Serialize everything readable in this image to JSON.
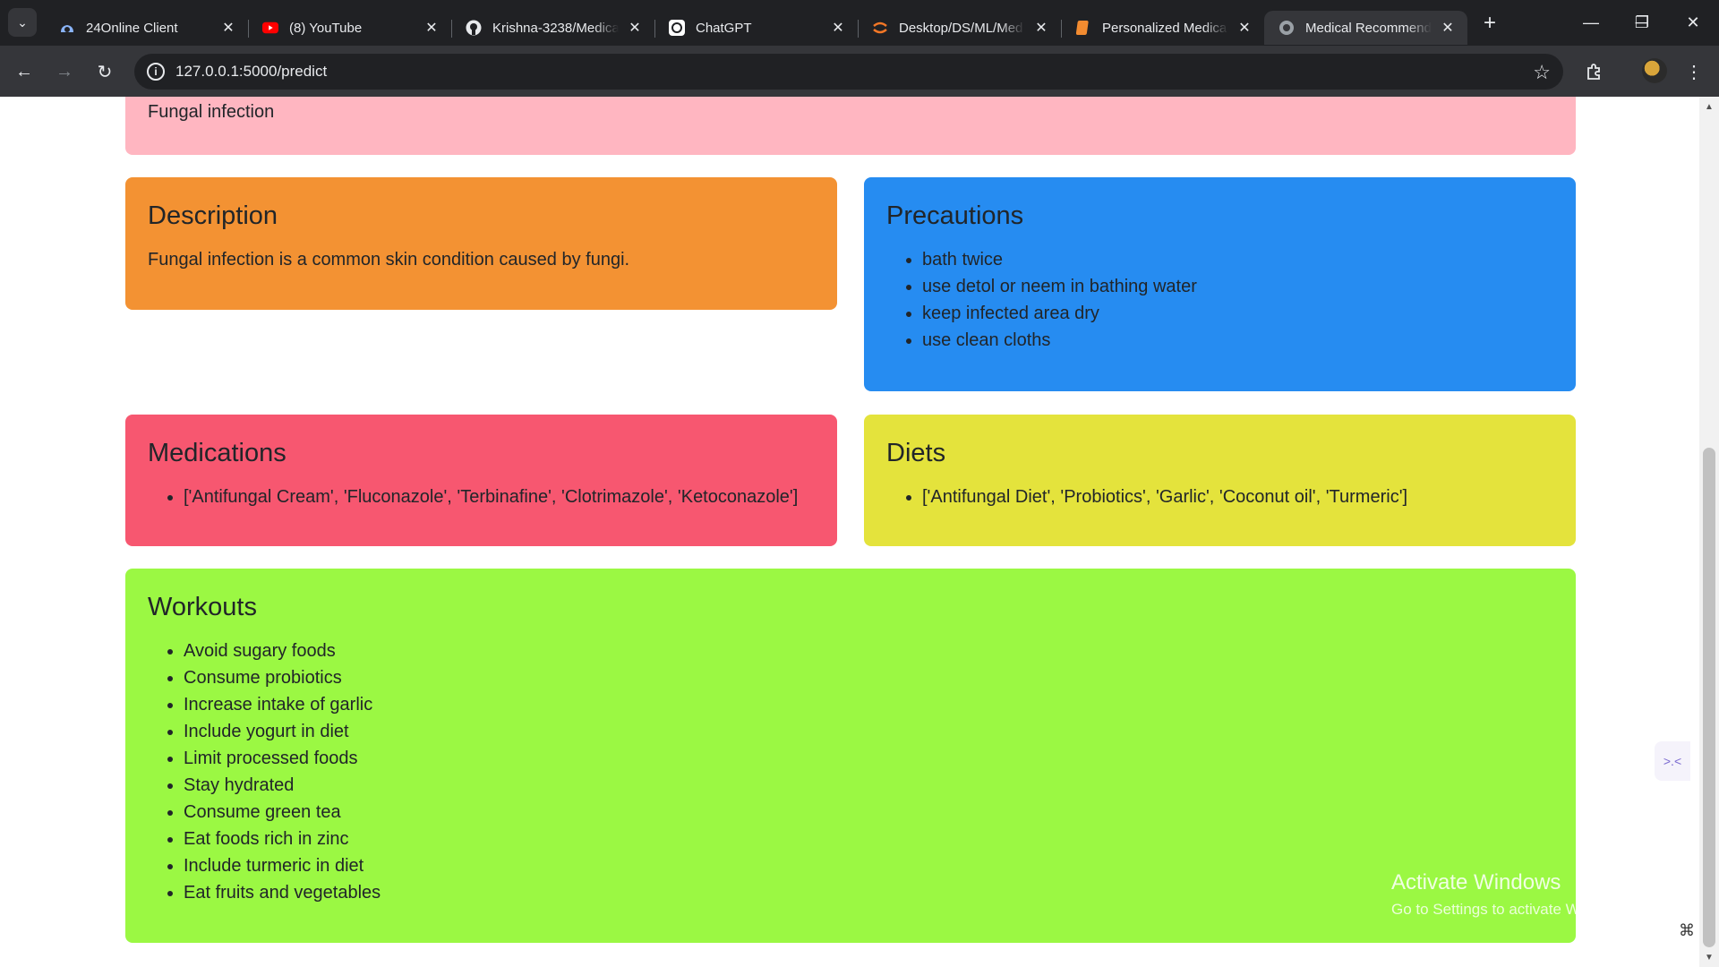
{
  "browser": {
    "tabs": [
      {
        "title": "24Online Client",
        "icon": "cloud-icon",
        "active": false
      },
      {
        "title": "(8) YouTube",
        "icon": "youtube-icon",
        "active": false
      },
      {
        "title": "Krishna-3238/Medica",
        "icon": "github-icon",
        "active": false
      },
      {
        "title": "ChatGPT",
        "icon": "chatgpt-icon",
        "active": false
      },
      {
        "title": "Desktop/DS/ML/Med",
        "icon": "jupyter-icon",
        "active": false
      },
      {
        "title": "Personalized Medica",
        "icon": "book-icon",
        "active": false
      },
      {
        "title": "Medical Recommend",
        "icon": "globe-icon",
        "active": true
      }
    ],
    "url": "127.0.0.1:5000/predict"
  },
  "page": {
    "disease": {
      "text": "Fungal infection"
    },
    "description": {
      "heading": "Description",
      "text": "Fungal infection is a common skin condition caused by fungi."
    },
    "precautions": {
      "heading": "Precautions",
      "items": [
        "bath twice",
        "use detol or neem in bathing water",
        "keep infected area dry",
        "use clean cloths"
      ]
    },
    "medications": {
      "heading": "Medications",
      "items": [
        "['Antifungal Cream', 'Fluconazole', 'Terbinafine', 'Clotrimazole', 'Ketoconazole']"
      ]
    },
    "diets": {
      "heading": "Diets",
      "items": [
        "['Antifungal Diet', 'Probiotics', 'Garlic', 'Coconut oil', 'Turmeric']"
      ]
    },
    "workouts": {
      "heading": "Workouts",
      "items": [
        "Avoid sugary foods",
        "Consume probiotics",
        "Increase intake of garlic",
        "Include yogurt in diet",
        "Limit processed foods",
        "Stay hydrated",
        "Consume green tea",
        "Eat foods rich in zinc",
        "Include turmeric in diet",
        "Eat fruits and vegetables"
      ]
    }
  },
  "os": {
    "activate_title": "Activate Windows",
    "activate_sub": "Go to Settings to activate Windows."
  },
  "colors": {
    "disease_bg": "#ffb6c1",
    "description_bg": "#f39233",
    "precautions_bg": "#268cf1",
    "medications_bg": "#f75770",
    "diets_bg": "#e4e33c",
    "workouts_bg": "#9bf843"
  }
}
